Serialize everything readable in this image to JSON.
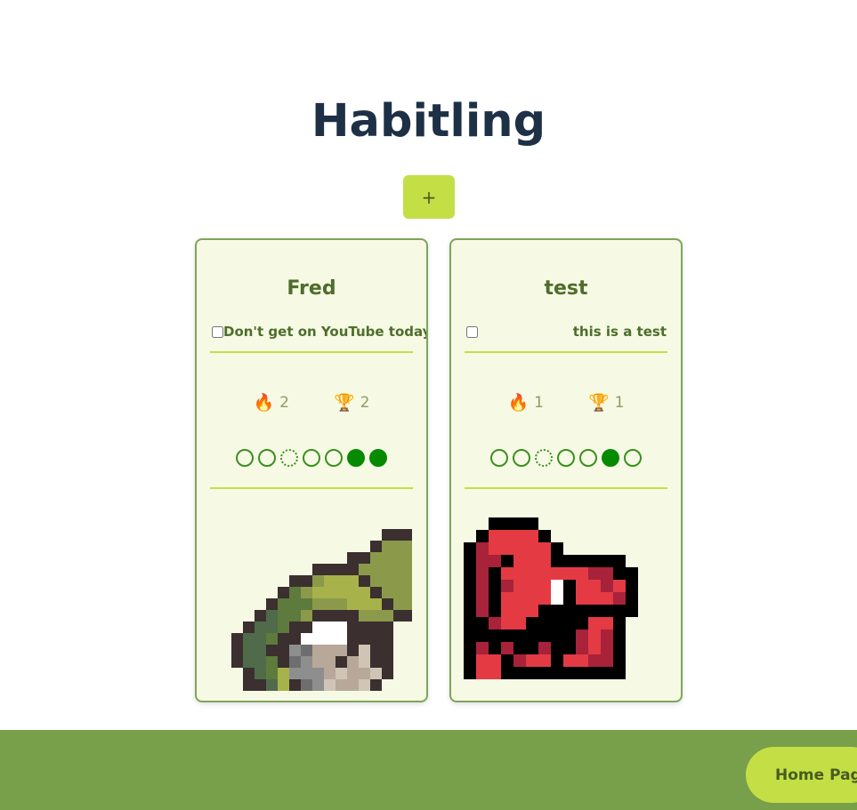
{
  "app": {
    "title": "Habitling",
    "add_label": "+"
  },
  "cards": [
    {
      "name": "Fred",
      "habit": "Don't get on YouTube today",
      "checked": false,
      "streak": "2",
      "best": "2",
      "streak_icon": "fire-emoji",
      "best_icon": "trophy-emoji",
      "days": [
        "empty",
        "empty",
        "today",
        "empty",
        "empty",
        "done",
        "done"
      ],
      "pet": "frog-on-rock"
    },
    {
      "name": "test",
      "habit": "this is a test",
      "checked": false,
      "streak": "1",
      "best": "1",
      "streak_icon": "fire-emoji",
      "best_icon": "trophy-emoji",
      "days": [
        "empty",
        "empty",
        "today",
        "empty",
        "empty",
        "done",
        "empty"
      ],
      "pet": "red-dragon"
    }
  ],
  "footer": {
    "home_label": "Home Page"
  },
  "colors": {
    "title": "#1e3046",
    "accent": "#c3df45",
    "card_bg": "#f6fae4",
    "card_border": "#7ea55a",
    "card_text": "#4e6e2c",
    "done": "#068a00",
    "footer": "#789f4a"
  },
  "icons": {
    "streak": "🔥",
    "best": "🏆"
  }
}
